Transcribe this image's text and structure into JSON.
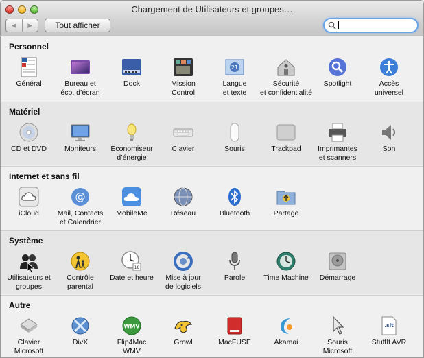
{
  "window": {
    "title": "Chargement de Utilisateurs et groupes…"
  },
  "toolbar": {
    "back_icon": "chevron-left-icon",
    "forward_icon": "chevron-right-icon",
    "show_all_label": "Tout afficher",
    "search_value": ""
  },
  "sections": {
    "personnel": {
      "title": "Personnel",
      "items": {
        "general": {
          "label": "Général",
          "icon": "general-icon"
        },
        "bureau": {
          "label": "Bureau et\néco. d’écran",
          "icon": "desktop-screensaver-icon"
        },
        "dock": {
          "label": "Dock",
          "icon": "dock-icon"
        },
        "mission": {
          "label": "Mission\nControl",
          "icon": "mission-control-icon"
        },
        "langue": {
          "label": "Langue\net texte",
          "icon": "language-icon"
        },
        "securite": {
          "label": "Sécurité\net confidentialité",
          "icon": "security-icon"
        },
        "spotlight": {
          "label": "Spotlight",
          "icon": "spotlight-icon"
        },
        "acces": {
          "label": "Accès\nuniversel",
          "icon": "accessibility-icon"
        }
      }
    },
    "materiel": {
      "title": "Matériel",
      "items": {
        "cddvd": {
          "label": "CD et DVD",
          "icon": "cd-dvd-icon"
        },
        "moniteurs": {
          "label": "Moniteurs",
          "icon": "displays-icon"
        },
        "economiseur": {
          "label": "Économiseur\nd’énergie",
          "icon": "energy-saver-icon"
        },
        "clavier": {
          "label": "Clavier",
          "icon": "keyboard-icon"
        },
        "souris": {
          "label": "Souris",
          "icon": "mouse-icon"
        },
        "trackpad": {
          "label": "Trackpad",
          "icon": "trackpad-icon"
        },
        "imprimantes": {
          "label": "Imprimantes\net scanners",
          "icon": "printer-icon"
        },
        "son": {
          "label": "Son",
          "icon": "sound-icon"
        }
      }
    },
    "internet": {
      "title": "Internet et sans fil",
      "items": {
        "icloud": {
          "label": "iCloud",
          "icon": "icloud-icon"
        },
        "mail": {
          "label": "Mail, Contacts\net Calendrier",
          "icon": "mail-contacts-icon"
        },
        "mobileme": {
          "label": "MobileMe",
          "icon": "mobileme-icon"
        },
        "reseau": {
          "label": "Réseau",
          "icon": "network-icon"
        },
        "bluetooth": {
          "label": "Bluetooth",
          "icon": "bluetooth-icon"
        },
        "partage": {
          "label": "Partage",
          "icon": "sharing-icon"
        }
      }
    },
    "systeme": {
      "title": "Système",
      "items": {
        "utilisateurs": {
          "label": "Utilisateurs et\ngroupes",
          "icon": "users-groups-icon"
        },
        "controle": {
          "label": "Contrôle\nparental",
          "icon": "parental-controls-icon"
        },
        "date": {
          "label": "Date et heure",
          "icon": "date-time-icon"
        },
        "maj": {
          "label": "Mise à jour\nde logiciels",
          "icon": "software-update-icon"
        },
        "parole": {
          "label": "Parole",
          "icon": "speech-icon"
        },
        "timemachine": {
          "label": "Time Machine",
          "icon": "time-machine-icon"
        },
        "demarrage": {
          "label": "Démarrage",
          "icon": "startup-disk-icon"
        }
      }
    },
    "autre": {
      "title": "Autre",
      "items": {
        "claviermicrosoft": {
          "label": "Clavier\nMicrosoft",
          "icon": "microsoft-keyboard-icon"
        },
        "divx": {
          "label": "DivX",
          "icon": "divx-icon"
        },
        "flip4mac": {
          "label": "Flip4Mac\nWMV",
          "icon": "flip4mac-icon",
          "badge": "WMV"
        },
        "growl": {
          "label": "Growl",
          "icon": "growl-icon"
        },
        "macfuse": {
          "label": "MacFUSE",
          "icon": "macfuse-icon"
        },
        "akamai": {
          "label": "Akamai",
          "icon": "akamai-icon"
        },
        "sourismicrosoft": {
          "label": "Souris\nMicrosoft",
          "icon": "microsoft-mouse-icon"
        },
        "stuffit": {
          "label": "StuffIt AVR",
          "icon": "stuffit-icon",
          "badge": ".sit"
        }
      }
    }
  },
  "colors": {
    "search_focus": "#6aa2e6",
    "section_alt_bg": "#e6e6e6",
    "window_bg": "#f0f0f0"
  }
}
